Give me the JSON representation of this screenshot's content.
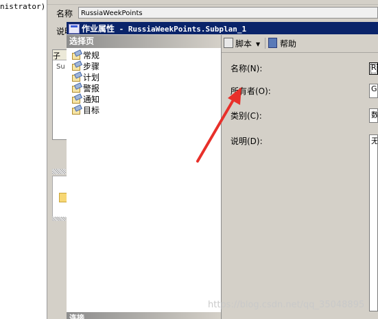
{
  "background": {
    "left_text": "nistrator)",
    "name_label": "名称",
    "name_value": "RussiaWeekPoints",
    "desc_label": "说明",
    "list_header": "子",
    "list_row": "Su"
  },
  "dialog": {
    "title_main": "作业属性",
    "title_sub": " - RussiaWeekPoints.Subplan_1",
    "page_panel_header": "选择页",
    "pages": [
      "常规",
      "步骤",
      "计划",
      "警报",
      "通知",
      "目标"
    ],
    "bottom_header": "连接",
    "toolbar": {
      "script_label": "脚本",
      "help_label": "帮助"
    },
    "fields": {
      "name_label": "名称(N):",
      "owner_label": "所有者(O):",
      "category_label": "类别(C):",
      "description_label": "说明(D):",
      "name_value": "R",
      "owner_value": "Gr",
      "category_value": "数",
      "description_value": "无"
    }
  },
  "colors": {
    "titlebar": "#0a246a",
    "arrow": "#e8302a",
    "face": "#d4d0c8"
  },
  "watermark": "https://blog.csdn.net/qq_35048895"
}
